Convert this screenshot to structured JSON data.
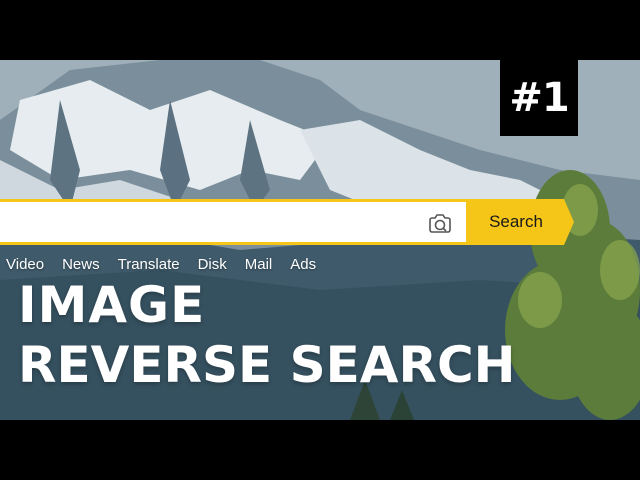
{
  "badge": {
    "text": "#1"
  },
  "search": {
    "value": "",
    "placeholder": "",
    "button_label": "Search",
    "camera_icon": "camera-icon"
  },
  "nav": {
    "items": [
      "Video",
      "News",
      "Translate",
      "Disk",
      "Mail",
      "Ads"
    ]
  },
  "title": {
    "line1": "IMAGE",
    "line2": "REVERSE SEARCH"
  },
  "colors": {
    "accent": "#f5c518",
    "text": "#ffffff",
    "letterbox": "#000000"
  }
}
